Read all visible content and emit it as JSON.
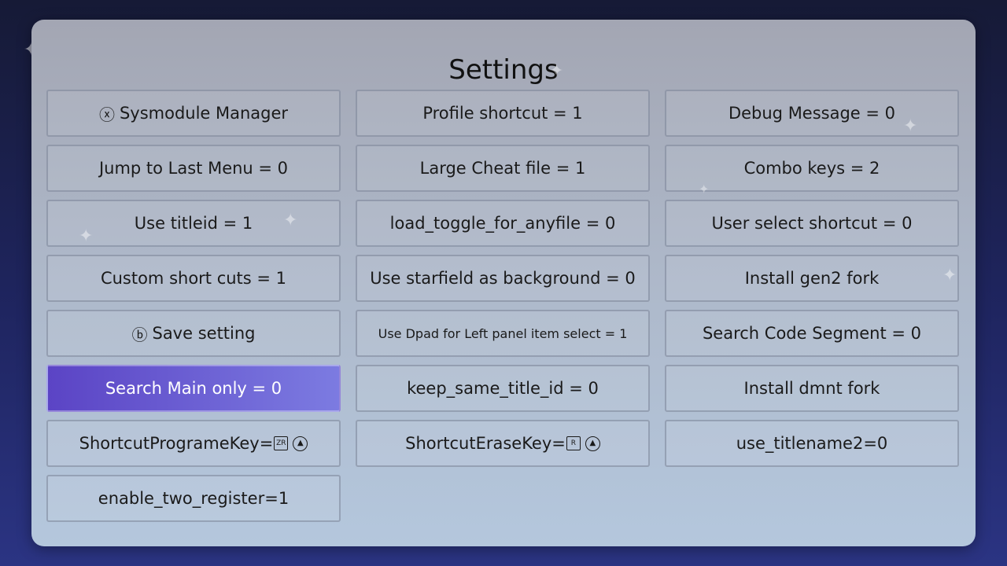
{
  "screen": {
    "title": "Settings"
  },
  "buttons": {
    "sysmodule_manager": {
      "icon": "x-button-icon",
      "glyph": "ⓧ",
      "label": "Sysmodule Manager"
    },
    "jump_to_last_menu": {
      "label": "Jump to Last Menu = 0"
    },
    "use_titleid": {
      "label": "Use titleid = 1"
    },
    "custom_short_cuts": {
      "label": "Custom short cuts = 1"
    },
    "save_setting": {
      "icon": "b-button-icon",
      "glyph": "ⓑ",
      "label": "Save setting"
    },
    "search_main_only": {
      "label": "Search Main only = 0"
    },
    "shortcut_program_key": {
      "label": "ShortcutProgrameKey=",
      "key_icon": "zr-button-icon",
      "key_text": "ZR",
      "extra_icon": "up-arrow-button-icon",
      "extra_glyph": "▲"
    },
    "enable_two_register": {
      "label": "enable_two_register=1"
    },
    "profile_shortcut": {
      "label": "Profile shortcut = 1"
    },
    "large_cheat_file": {
      "label": "Large Cheat file = 1"
    },
    "load_toggle_for_anyfile": {
      "label": "load_toggle_for_anyfile = 0"
    },
    "use_starfield": {
      "label": "Use starfield as background = 0"
    },
    "use_dpad": {
      "label": "Use Dpad for Left panel item select = 1"
    },
    "keep_same_title_id": {
      "label": "keep_same_title_id = 0"
    },
    "shortcut_erase_key": {
      "label": "ShortcutEraseKey=",
      "key_icon": "r-button-icon",
      "key_text": "R",
      "extra_icon": "up-arrow-button-icon",
      "extra_glyph": "▲"
    },
    "debug_message": {
      "label": "Debug Message = 0"
    },
    "combo_keys": {
      "label": "Combo keys = 2"
    },
    "user_select_shortcut": {
      "label": "User select shortcut = 0"
    },
    "install_gen2_fork": {
      "label": "Install gen2 fork"
    },
    "search_code_segment": {
      "label": "Search Code Segment = 0"
    },
    "install_dmnt_fork": {
      "label": "Install dmnt fork"
    },
    "use_titlename2": {
      "label": "use_titlename2=0"
    }
  },
  "colors": {
    "selected_start": "#5b44c5",
    "selected_end": "#7c7be1",
    "panel_top": "#a3a6b3",
    "panel_bottom": "#b4c7dd"
  },
  "selected_item": "Search Main only = 0"
}
